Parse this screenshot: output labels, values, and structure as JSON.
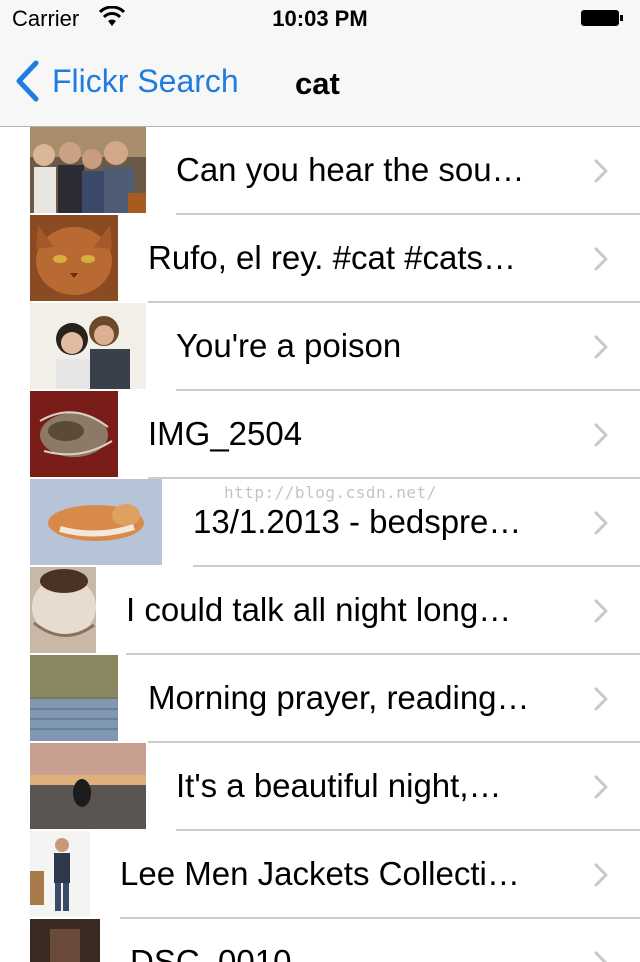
{
  "status_bar": {
    "carrier": "Carrier",
    "time": "10:03 PM"
  },
  "nav_bar": {
    "back_label": "Flickr Search",
    "title": "cat"
  },
  "watermark": "http://blog.csdn.net/",
  "rows": [
    {
      "title": "Can you hear the sou…"
    },
    {
      "title": "Rufo, el rey. #cat #cats…"
    },
    {
      "title": "You're a poison"
    },
    {
      "title": "IMG_2504"
    },
    {
      "title": "13/1.2013 - bedspre…"
    },
    {
      "title": "I could talk all night long…"
    },
    {
      "title": "Morning prayer, reading…"
    },
    {
      "title": "It's a beautiful night,…"
    },
    {
      "title": "Lee Men Jackets Collecti…"
    },
    {
      "title": "DSC_0010"
    }
  ],
  "colors": {
    "tint": "#1f7de0",
    "separator": "#cdcdcd",
    "bar_bg": "#f7f7f7"
  }
}
